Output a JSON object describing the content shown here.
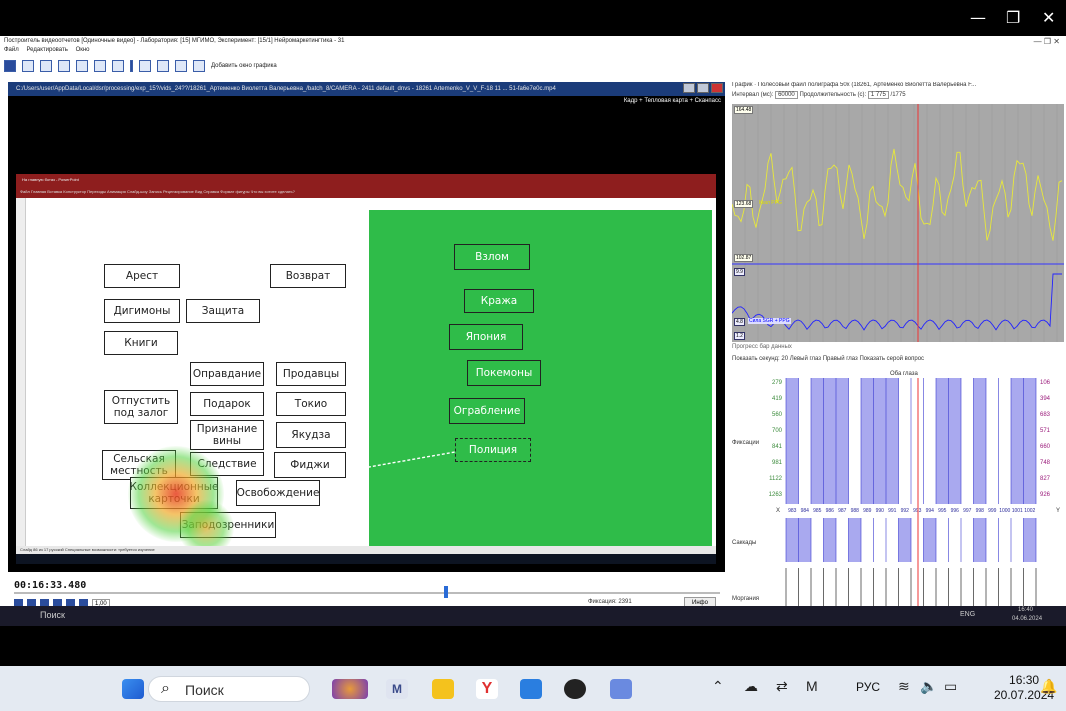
{
  "window": {
    "minimize": "—",
    "restore": "❐",
    "close": "✕"
  },
  "app": {
    "title": "Построитель видеоотчетов [Одиночные видео] - Лаборатория: [15] МГИМО, Эксперимент: [15/1] Нейромаркетингтика - 31",
    "menu": [
      "Файл",
      "Редактировать",
      "Окно"
    ],
    "add_graph_window": "Добавить окно графика",
    "controls": "—  ❐  ✕"
  },
  "video": {
    "title": "C:/Users/user/AppData/Local/dsr/processing/exp_15?/vids_24??/18261_Артеменко Виолетта Валерьевна_/batch_8/CAMERA - 2411 default_dnvs - 18261 Artemenko_V_V_F-18 11 ... 51-fa6e7e0c.mp4",
    "overlay_label": "Кадр + Тепловая карта + Сканпасс",
    "pp_title": "На главную ботаз - PowerPoint",
    "pp_ribbon": "Файл  Главная  Вставка  Конструктор  Переходы  Анимация  Слайд-шоу  Запись  Рецензирование  Вид  Справка  Формат фигуры  Что вы хотите сделать?",
    "pp_status": "Слайд 86 из 17   русский   Специальные возможности: требуется изучение",
    "slide_left_cards": [
      {
        "label": "Арест"
      },
      {
        "label": "Возврат"
      },
      {
        "label": "Дигимоны"
      },
      {
        "label": "Защита"
      },
      {
        "label": "Книги"
      },
      {
        "label": "Оправдание"
      },
      {
        "label": "Продавцы"
      },
      {
        "label": "Отпустить под залог"
      },
      {
        "label": "Подарок"
      },
      {
        "label": "Токио"
      },
      {
        "label": "Признание вины"
      },
      {
        "label": "Якудза"
      },
      {
        "label": "Сельская местность"
      },
      {
        "label": "Следствие"
      },
      {
        "label": "Фиджи"
      },
      {
        "label": "Коллекционные карточки"
      },
      {
        "label": "Освобождение"
      },
      {
        "label": "Заподозренники"
      }
    ],
    "slide_right_cards": [
      {
        "label": "Взлом"
      },
      {
        "label": "Кража"
      },
      {
        "label": "Япония"
      },
      {
        "label": "Покемоны"
      },
      {
        "label": "Ограбление"
      },
      {
        "label": "Полиция"
      }
    ]
  },
  "controls": {
    "timecode": "00:16:33.480",
    "speed": "1,00",
    "fixations": "Фиксация: 2391",
    "info": "Инфо"
  },
  "graph": {
    "title": "График · Полесовый файл полиграфа 50х (18261, Артеменко Виолетта Валерьевна F...",
    "interval_label": "Интервал (мс):",
    "interval_value": "60000",
    "duration_label": "Продолжительность (с):",
    "duration_value": "1 775",
    "duration_max": "/1775",
    "ppg_label": "Ккал PPG",
    "sgr_label": "Сила SGR + PPG",
    "axis_top": "164.48",
    "axis_mid": "123.68",
    "axis_lo": "102.87",
    "axis_hi2": "9.9",
    "axis_sgr": "4.8",
    "axis_bottom": "1.2"
  },
  "progress": {
    "title": "Прогресс бар данных",
    "opts": "Показать секунд: 20  Левый глаз  Правый глаз  Показать серой вопрос",
    "eye_label": "Оба глаза",
    "left_ticks": [
      "279",
      "419",
      "560",
      "700",
      "841",
      "981",
      "1122",
      "1263"
    ],
    "right_ticks": [
      "106",
      "394",
      "683",
      "571",
      "660",
      "748",
      "827",
      "926"
    ],
    "x_ticks": [
      "983",
      "984",
      "985",
      "986",
      "987",
      "988",
      "989",
      "990",
      "991",
      "992",
      "993",
      "994",
      "995",
      "996",
      "997",
      "998",
      "999",
      "1000",
      "1001",
      "1002"
    ],
    "row_fix": "Фиксации",
    "row_sacc": "Саккады",
    "row_blink": "Моргания",
    "x_axis": "X",
    "y_axis": "Y"
  },
  "inner_taskbar": {
    "search": "Поиск",
    "lang": "ENG",
    "time": "16:40",
    "date": "04.06.2024"
  },
  "taskbar": {
    "search": "Поиск",
    "lang": "РУС",
    "time": "16:30",
    "date": "20.07.2024"
  }
}
